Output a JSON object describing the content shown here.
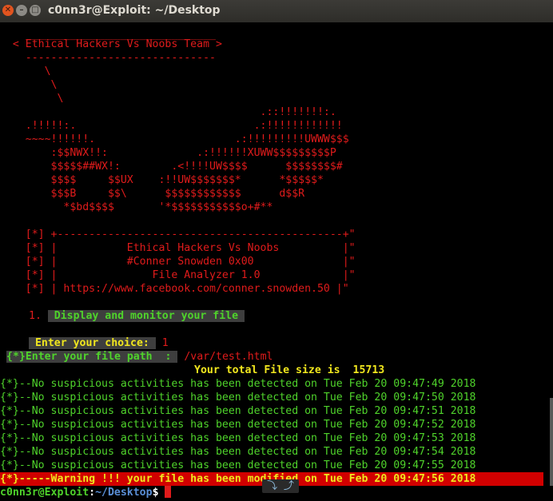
{
  "window": {
    "title": "c0nn3r@Exploit: ~/Desktop"
  },
  "banner": {
    "top_rule": "    ______________________________",
    "team_line": "  < Ethical Hackers Vs Noobs Team >",
    "bottom_rule": "    ------------------------------",
    "art": [
      "       \\",
      "        \\",
      "         \\",
      "                                         .::!!!!!!!:.",
      "    .!!!!!:.                            .:!!!!!!!!!!!!",
      "    ~~~~!!!!!!.                      .:!!!!!!!!!UWWW$$$",
      "        :$$NWX!!:              .:!!!!!!XUWW$$$$$$$$$P",
      "        $$$$$##WX!:        .<!!!!UW$$$$      $$$$$$$$#",
      "        $$$$     $$UX    :!!UW$$$$$$$*      *$$$$$*",
      "        $$$B     $$\\      $$$$$$$$$$$$      d$$R",
      "          *$bd$$$$       '*$$$$$$$$$$$o+#**"
    ]
  },
  "info_box": [
    "    [*] +---------------------------------------------+\"",
    "    [*] |           Ethical Hackers Vs Noobs          |\"",
    "    [*] |           #Conner Snowden 0x00              |\"",
    "    [*] |               File Analyzer 1.0             |\"",
    "    [*] | https://www.facebook.com/conner.snowden.50 |\""
  ],
  "menu": {
    "number": "1.",
    "option": " Display and monitor your file "
  },
  "prompt": {
    "choice_label": " Enter your choice: ",
    "choice_value": "1",
    "path_label": "{*}Enter your file path  : ",
    "path_value": "/var/test.html"
  },
  "file_size": {
    "label": "Your total File size is",
    "value": "15713"
  },
  "log": [
    "{*}--No suspicious activities has been detected on Tue Feb 20 09:47:49 2018",
    "{*}--No suspicious activities has been detected on Tue Feb 20 09:47:50 2018",
    "{*}--No suspicious activities has been detected on Tue Feb 20 09:47:51 2018",
    "{*}--No suspicious activities has been detected on Tue Feb 20 09:47:52 2018",
    "{*}--No suspicious activities has been detected on Tue Feb 20 09:47:53 2018",
    "{*}--No suspicious activities has been detected on Tue Feb 20 09:47:54 2018",
    "{*}--No suspicious activities has been detected on Tue Feb 20 09:47:55 2018"
  ],
  "warning": "{*}-----Warning !!! your file has been modified on Tue Feb 20 09:47:56 2018",
  "shell_prompt": {
    "user_host": "c0nn3r@Exploit",
    "sep": ":",
    "path": "~/Desktop",
    "symbol": "$"
  },
  "icons": {
    "close": "close-icon",
    "minimize": "minimize-icon",
    "maximize": "maximize-icon",
    "scroll": "scroll-arrows-icon"
  }
}
